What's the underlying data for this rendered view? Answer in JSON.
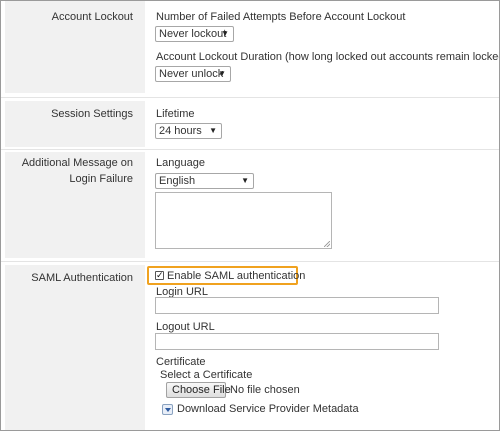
{
  "lockout": {
    "label": "Account Lockout",
    "attempts_label": "Number of Failed Attempts Before Account Lockout",
    "attempts_value": "Never lockout",
    "duration_label": "Account Lockout Duration (how long locked out accounts remain locked out)",
    "duration_value": "Never unlock"
  },
  "session": {
    "label": "Session Settings",
    "lifetime_label": "Lifetime",
    "lifetime_value": "24 hours"
  },
  "message": {
    "label_line1": "Additional Message on",
    "label_line2": "Login Failure",
    "language_label": "Language",
    "language_value": "English",
    "text_value": ""
  },
  "saml": {
    "label": "SAML Authentication",
    "enable_label": "Enable SAML authentication",
    "enable_checked": true,
    "login_url_label": "Login URL",
    "login_url_value": "",
    "logout_url_label": "Logout URL",
    "logout_url_value": "",
    "certificate_label": "Certificate",
    "select_certificate_label": "Select a Certificate",
    "choose_file_label": "Choose File",
    "no_file_text": "No file chosen",
    "download_label": "Download Service Provider Metadata"
  },
  "colors": {
    "label_bg": "#f1f1f1",
    "highlight": "#f0a21f"
  },
  "icons": {
    "dropdown": "chevron-down-icon",
    "download": "download-icon",
    "checkbox": "checkmark-icon"
  }
}
